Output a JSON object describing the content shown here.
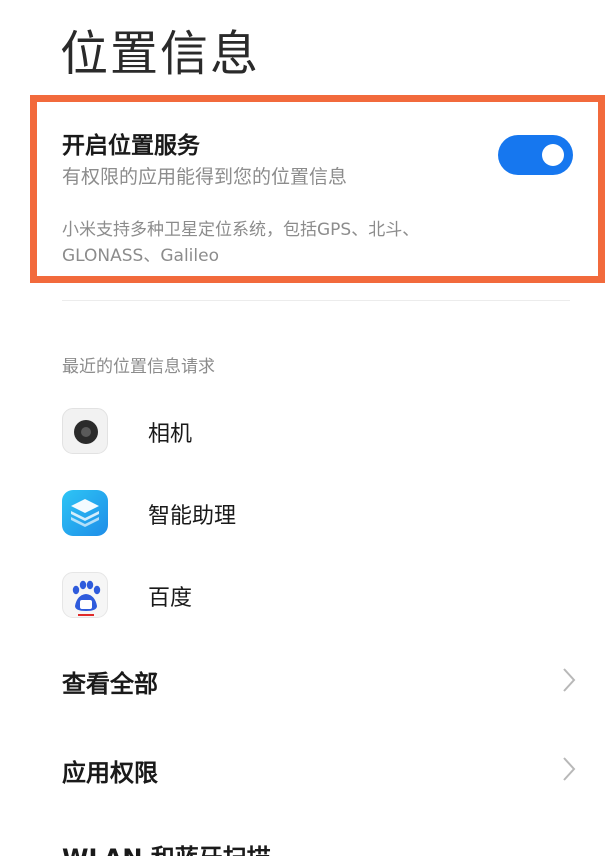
{
  "page_title": "位置信息",
  "location_service": {
    "title": "开启位置服务",
    "subtitle": "有权限的应用能得到您的位置信息",
    "toggle_on": true,
    "description": "小米支持多种卫星定位系统，包括GPS、北斗、GLONASS、Galileo"
  },
  "recent_requests": {
    "header": "最近的位置信息请求",
    "apps": [
      {
        "label": "相机",
        "icon": "camera-icon"
      },
      {
        "label": "智能助理",
        "icon": "assistant-icon"
      },
      {
        "label": "百度",
        "icon": "baidu-icon"
      }
    ]
  },
  "nav": {
    "view_all": "查看全部",
    "app_permissions": "应用权限",
    "wlan_bt_scan": "WLAN 和蓝牙扫描"
  },
  "colors": {
    "accent": "#1677ef",
    "highlight": "#f26a3c"
  }
}
